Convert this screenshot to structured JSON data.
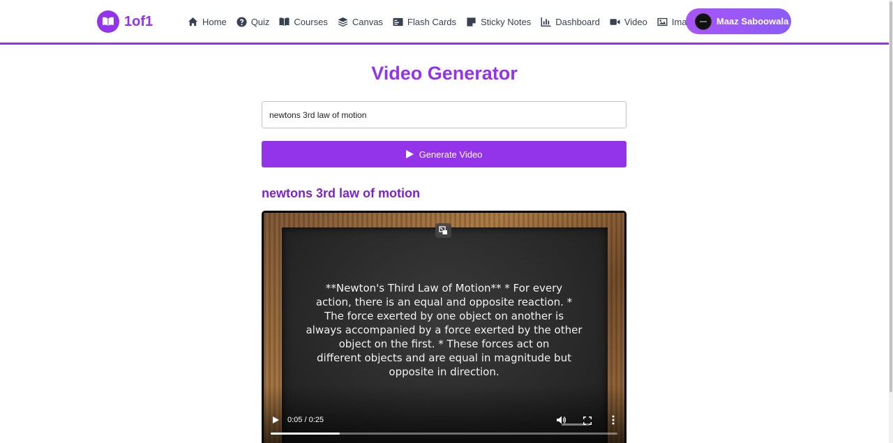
{
  "brand": {
    "name": "1of1"
  },
  "nav": [
    {
      "label": "Home",
      "icon": "home-icon"
    },
    {
      "label": "Quiz",
      "icon": "question-icon"
    },
    {
      "label": "Courses",
      "icon": "book-icon"
    },
    {
      "label": "Canvas",
      "icon": "layers-icon"
    },
    {
      "label": "Flash Cards",
      "icon": "cards-icon"
    },
    {
      "label": "Sticky Notes",
      "icon": "sticky-note-icon"
    },
    {
      "label": "Dashboard",
      "icon": "chart-icon"
    },
    {
      "label": "Video",
      "icon": "video-icon"
    },
    {
      "label": "Image",
      "icon": "image-icon"
    }
  ],
  "user": {
    "name": "Maaz Saboowala"
  },
  "main": {
    "title": "Video Generator",
    "input_value": "newtons 3rd law of motion",
    "generate_label": "Generate Video",
    "video_title": "newtons 3rd law of motion"
  },
  "video": {
    "board_lines": [
      "**Newton's Third Law of Motion**  * For every",
      "action, there is an equal and opposite reaction. *",
      "The force exerted by one object on another is",
      "always accompanied by a force exerted by the other",
      "object on the first. * These forces act on",
      "different objects and are equal in magnitude but",
      "opposite in direction."
    ],
    "time": "0:05 / 0:25",
    "progress": 0.2
  },
  "colors": {
    "accent": "#9333ea",
    "accent_dark": "#7e22ce"
  }
}
